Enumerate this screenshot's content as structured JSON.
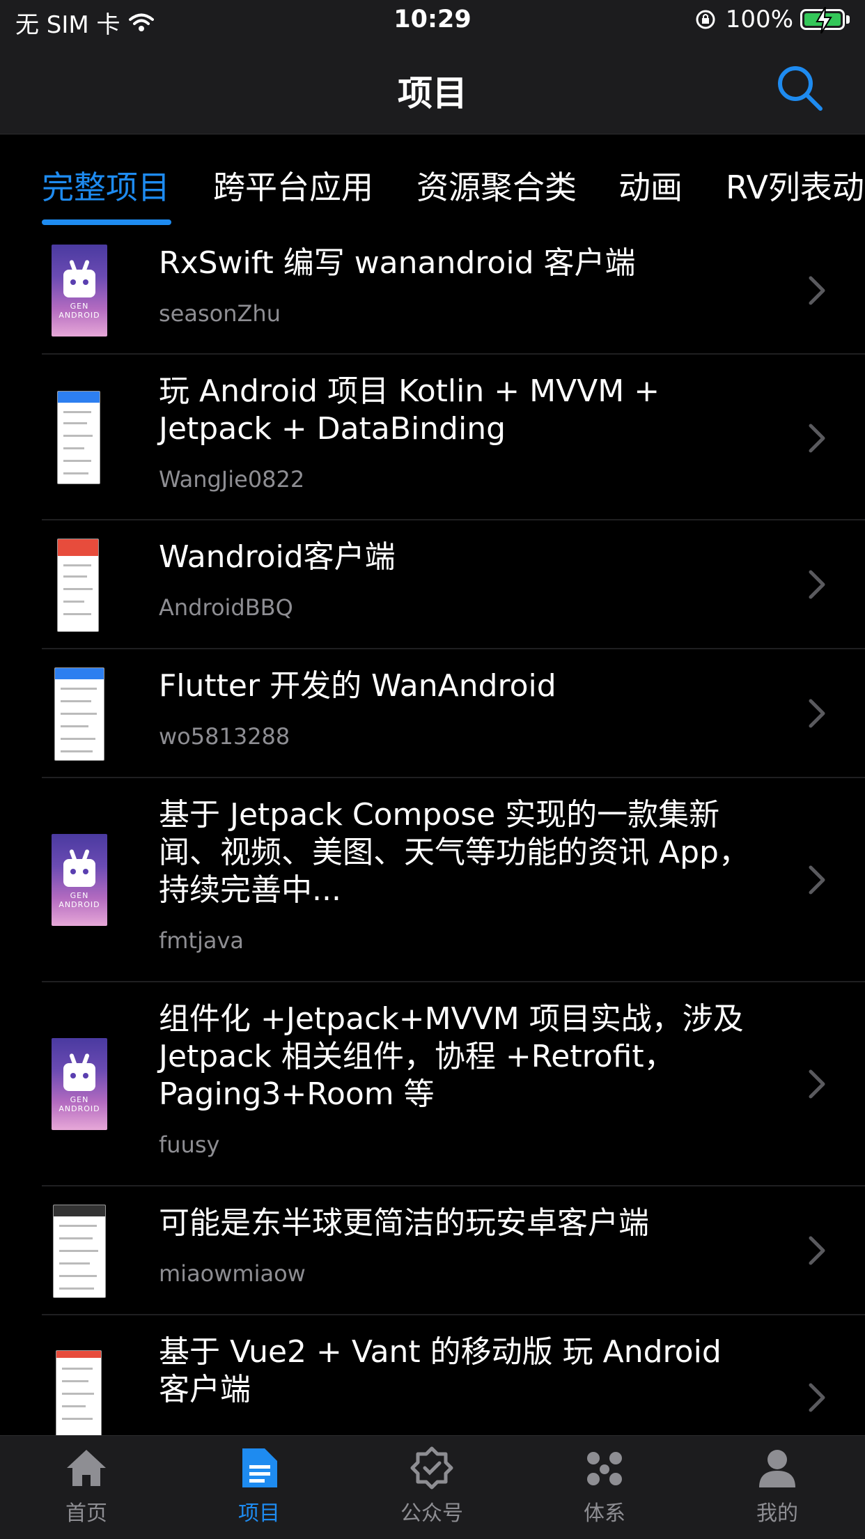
{
  "status_bar": {
    "carrier": "无 SIM 卡",
    "time": "10:29",
    "battery": "100%"
  },
  "nav": {
    "title": "项目"
  },
  "tabs": [
    {
      "label": "完整项目",
      "active": true
    },
    {
      "label": "跨平台应用",
      "active": false
    },
    {
      "label": "资源聚合类",
      "active": false
    },
    {
      "label": "动画",
      "active": false
    },
    {
      "label": "RV列表动",
      "active": false
    }
  ],
  "items": [
    {
      "title": "RxSwift 编写 wanandroid 客户端",
      "author": "seasonZhu",
      "thumb": "android-logo",
      "thumb_caption": "GEN ANDROID"
    },
    {
      "title": "玩 Android 项目 Kotlin + MVVM + Jetpack + DataBinding",
      "author": "WangJie0822",
      "thumb": "app-screenshot"
    },
    {
      "title": "Wandroid客户端",
      "author": "AndroidBBQ",
      "thumb": "app-screenshot"
    },
    {
      "title": "Flutter 开发的 WanAndroid",
      "author": "wo5813288",
      "thumb": "app-screenshot"
    },
    {
      "title": "基于 Jetpack Compose 实现的一款集新闻、视频、美图、天气等功能的资讯 App，持续完善中...",
      "author": "fmtjava",
      "thumb": "android-logo",
      "thumb_caption": "GEN ANDROID"
    },
    {
      "title": "组件化 +Jetpack+MVVM 项目实战，涉及 Jetpack 相关组件，协程 +Retrofit，Paging3+Room 等",
      "author": "fuusy",
      "thumb": "android-logo",
      "thumb_caption": "GEN ANDROID"
    },
    {
      "title": "可能是东半球更简洁的玩安卓客户端",
      "author": "miaowmiaow",
      "thumb": "app-screenshot"
    },
    {
      "title": "基于 Vue2 + Vant 的移动版 玩 Android 客户端",
      "author": "",
      "thumb": "app-screenshot"
    }
  ],
  "tabbar": [
    {
      "label": "首页",
      "icon": "home-icon",
      "active": false
    },
    {
      "label": "项目",
      "icon": "folder-icon",
      "active": true
    },
    {
      "label": "公众号",
      "icon": "badge-check-icon",
      "active": false
    },
    {
      "label": "体系",
      "icon": "nodes-icon",
      "active": false
    },
    {
      "label": "我的",
      "icon": "user-icon",
      "active": false
    }
  ],
  "colors": {
    "accent": "#1e8bf0",
    "background": "#000000",
    "bar": "#1c1c1e",
    "secondary_text": "#8e8e93"
  }
}
